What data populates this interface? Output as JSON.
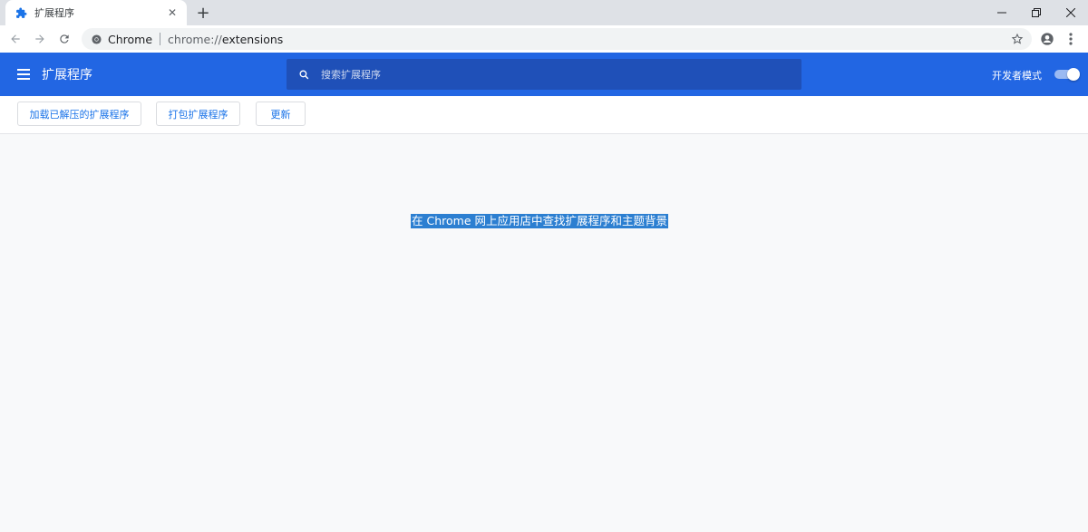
{
  "tab": {
    "title": "扩展程序",
    "favicon": "puzzle-piece-icon",
    "close_glyph": "✕"
  },
  "new_tab_glyph": "+",
  "omnibox": {
    "scheme_label": "Chrome",
    "url_prefix": "chrome://",
    "url_path": "extensions"
  },
  "header": {
    "title": "扩展程序",
    "search_placeholder": "搜索扩展程序",
    "dev_mode_label": "开发者模式",
    "dev_mode_enabled": true
  },
  "actions": {
    "load_unpacked": "加载已解压的扩展程序",
    "pack": "打包扩展程序",
    "update": "更新"
  },
  "main": {
    "store_link": "在 Chrome 网上应用店中查找扩展程序和主题背景"
  },
  "colors": {
    "brand_blue": "#2266e3",
    "search_bg": "#1f50b8",
    "link_blue": "#1a73e8",
    "selection": "#2c7fd1"
  }
}
